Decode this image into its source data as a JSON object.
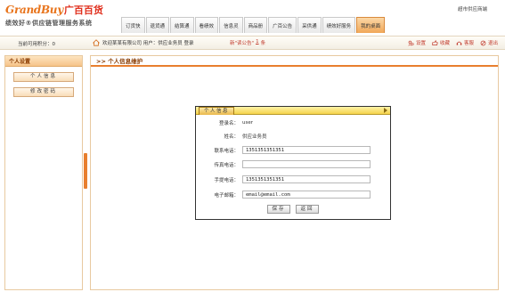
{
  "header": {
    "logo_en": "GrandBuy",
    "logo_cn": "广百百货",
    "tagline": "绩效好®供应链管理服务系统",
    "top_link": "超市供应商端",
    "tabs": [
      {
        "label": "订货快"
      },
      {
        "label": "退货通"
      },
      {
        "label": "结算通"
      },
      {
        "label": "看绩效"
      },
      {
        "label": "信息灵"
      },
      {
        "label": "商品册"
      },
      {
        "label": "广百公告"
      },
      {
        "label": "采供通"
      },
      {
        "label": "绩效好服务"
      },
      {
        "label": "我的桌面"
      }
    ],
    "active_tab": "我的桌面"
  },
  "infobar": {
    "points_label": "当前可用积分：0",
    "welcome": "欢迎某某有限公司 用户：供应业务员 登录",
    "notice_prefix": "新\"读公告\"",
    "notice_count": "1",
    "notice_suffix": "条",
    "tools": [
      {
        "label": "设置",
        "icon": "settings-icon"
      },
      {
        "label": "收藏",
        "icon": "favorites-icon"
      },
      {
        "label": "客服",
        "icon": "customer-service-icon"
      },
      {
        "label": "退出",
        "icon": "logout-icon"
      }
    ]
  },
  "sidebar": {
    "title": "个人设置",
    "items": [
      {
        "label": "个人信息"
      },
      {
        "label": "修改密码"
      }
    ]
  },
  "main": {
    "title": ">>  个人信息维护"
  },
  "form": {
    "tab_label": "个人信息",
    "login_label": "登录名：",
    "login_value": "user",
    "name_label": "姓名：",
    "name_value": "供应业务员",
    "phone_label": "联系电话：",
    "phone_value": "1351351351351",
    "fax_label": "传真电话：",
    "fax_value": "",
    "mobile_label": "手提电话：",
    "mobile_value": "1351351351351",
    "email_label": "电子邮箱：",
    "email_value": "email@email.com",
    "save_label": "保存",
    "back_label": "返回"
  },
  "colors": {
    "brand_orange": "#e87f2e",
    "brand_red": "#e0301e",
    "active_tab": "#f1a758"
  }
}
